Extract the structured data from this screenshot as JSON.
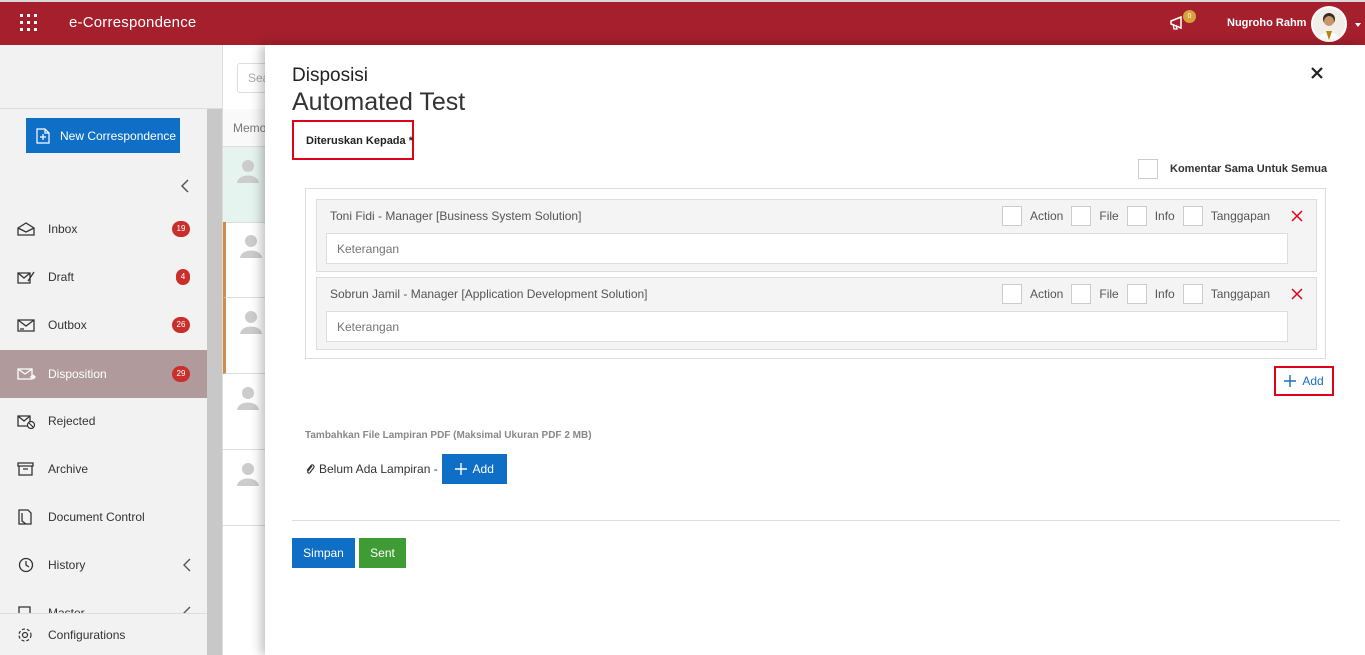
{
  "header": {
    "app_title": "e-Correspondence",
    "notification_count": "0",
    "username": "Nugroho Rahm",
    "accent": "#a51f2c"
  },
  "sidebar": {
    "new_button": "New Correspondence",
    "items": [
      {
        "label": "Inbox",
        "badge": "19",
        "icon": "inbox-icon"
      },
      {
        "label": "Draft",
        "badge": "4",
        "icon": "draft-icon"
      },
      {
        "label": "Outbox",
        "badge": "26",
        "icon": "outbox-icon"
      },
      {
        "label": "Disposition",
        "badge": "29",
        "icon": "disposition-icon",
        "active": true
      },
      {
        "label": "Rejected",
        "badge": "",
        "icon": "rejected-icon"
      },
      {
        "label": "Archive",
        "badge": "",
        "icon": "archive-icon"
      },
      {
        "label": "Document Control",
        "badge": "",
        "icon": "document-icon"
      },
      {
        "label": "History",
        "badge": "",
        "icon": "history-icon"
      },
      {
        "label": "Master",
        "badge": "",
        "icon": "master-icon"
      }
    ],
    "configurations": "Configurations"
  },
  "list": {
    "search_placeholder": "Sea",
    "column_header": "Memo"
  },
  "modal": {
    "title": "Disposisi",
    "subtitle": "Automated Test",
    "forward_label": "Diteruskan Kepada *",
    "same_comment_label": "Komentar Sama Untuk Semua",
    "recipients": [
      {
        "name": "Toni Fidi - Manager [Business System Solution]",
        "options": [
          "Action",
          "File",
          "Info",
          "Tanggapan"
        ],
        "placeholder": "Keterangan"
      },
      {
        "name": "Sobrun Jamil - Manager [Application Development Solution]",
        "options": [
          "Action",
          "File",
          "Info",
          "Tanggapan"
        ],
        "placeholder": "Keterangan"
      }
    ],
    "add_label": "Add",
    "attach_title": "Tambahkan File Lampiran PDF (Maksimal Ukuran PDF 2 MB)",
    "attach_status": "Belum Ada Lampiran -",
    "attach_add_label": "Add",
    "save_label": "Simpan",
    "sent_label": "Sent"
  }
}
